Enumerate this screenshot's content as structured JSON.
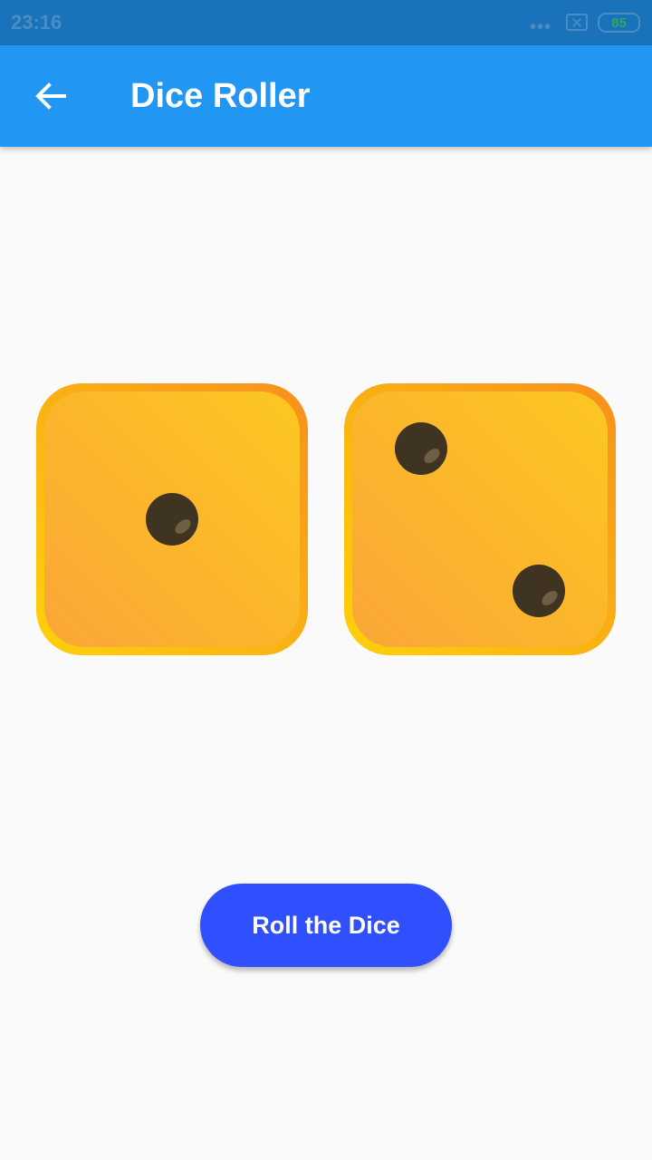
{
  "status_bar": {
    "time": "23:16",
    "dots": "•••",
    "sim_icon": "sim-missing-icon",
    "battery": "85"
  },
  "app_bar": {
    "back_icon": "arrow-back-icon",
    "title": "Dice Roller",
    "color": "#2196F3"
  },
  "dice": [
    {
      "value": 1,
      "icon": "dice-one-icon"
    },
    {
      "value": 2,
      "icon": "dice-two-icon"
    }
  ],
  "roll_button": {
    "label": "Roll the Dice",
    "color": "#304FFE"
  }
}
